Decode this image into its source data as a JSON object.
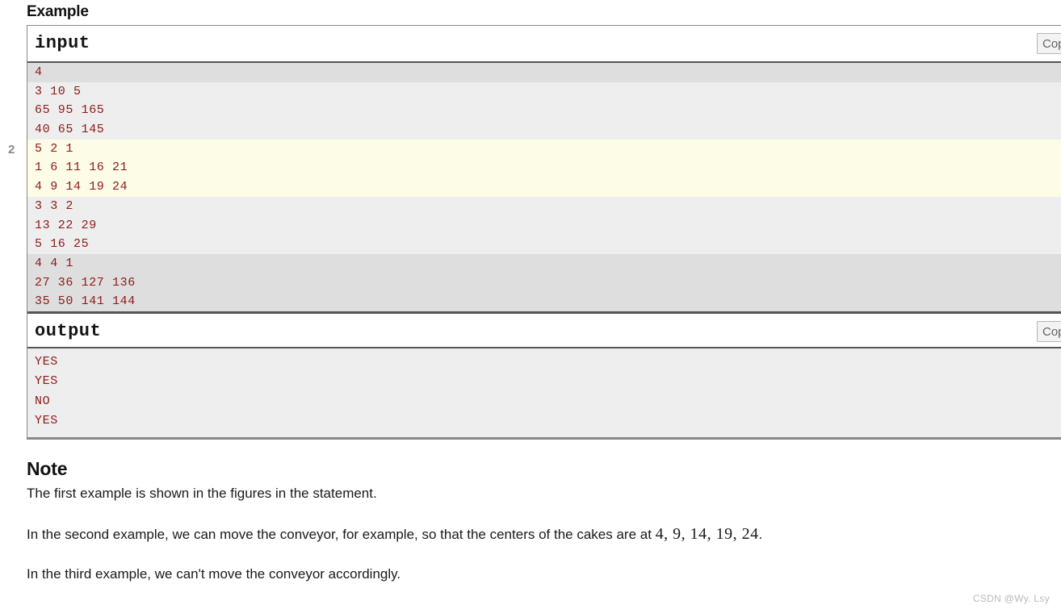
{
  "example": {
    "heading": "Example",
    "input_block": {
      "title": "input",
      "copy_label": "Copy",
      "groups": [
        {
          "index_label": "",
          "shade": "dark",
          "lines": [
            "4"
          ]
        },
        {
          "index_label": "",
          "shade": "light",
          "lines": [
            "3 10 5",
            "65 95 165",
            "40 65 145"
          ]
        },
        {
          "index_label": "2",
          "shade": "hl",
          "lines": [
            "5 2 1",
            "1 6 11 16 21",
            "4 9 14 19 24"
          ]
        },
        {
          "index_label": "",
          "shade": "light",
          "lines": [
            "3 3 2",
            "13 22 29",
            "5 16 25"
          ]
        },
        {
          "index_label": "",
          "shade": "dark",
          "lines": [
            "4 4 1",
            "27 36 127 136",
            "35 50 141 144"
          ]
        }
      ]
    },
    "output_block": {
      "title": "output",
      "copy_label": "Copy",
      "lines": [
        "YES",
        "YES",
        "NO",
        "YES"
      ]
    }
  },
  "note": {
    "heading": "Note",
    "paragraphs": [
      {
        "text": "The first example is shown in the figures in the statement."
      },
      {
        "text_before": "In the second example, we can move the conveyor, for example, so that the centers of the cakes are at ",
        "math": "4, 9, 14, 19, 24",
        "text_after": "."
      },
      {
        "text": "In the third example, we can't move the conveyor accordingly."
      }
    ]
  },
  "watermark": {
    "text": "CSDN @Wy. Lsy"
  },
  "colors": {
    "code_text": "#8c1919",
    "shade_dark": "#dedede",
    "shade_light": "#eeeeee",
    "shade_highlight": "#fdfce7",
    "border": "#888888",
    "copy_text": "#666666"
  }
}
